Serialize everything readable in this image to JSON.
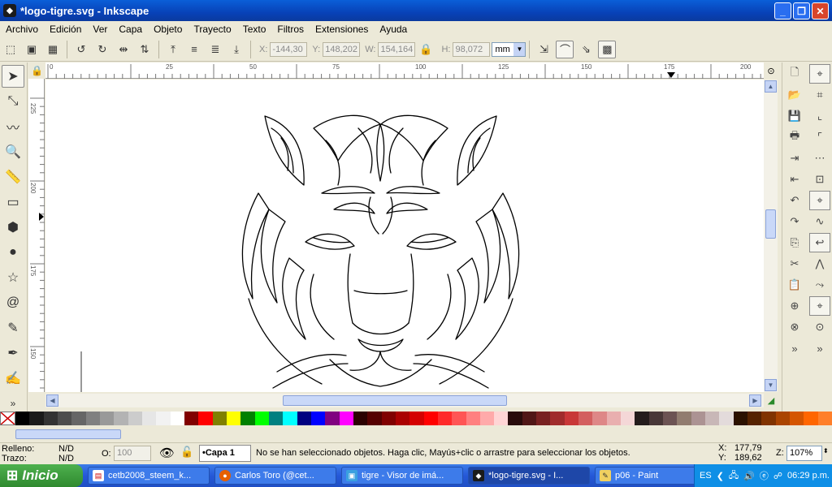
{
  "window": {
    "title": "*logo-tigre.svg - Inkscape",
    "icon": "inkscape-icon"
  },
  "menu": [
    "Archivo",
    "Edición",
    "Ver",
    "Capa",
    "Objeto",
    "Trayecto",
    "Texto",
    "Filtros",
    "Extensiones",
    "Ayuda"
  ],
  "toolbar": {
    "x_label": "X:",
    "x_value": "-144,30",
    "y_label": "Y:",
    "y_value": "148,202",
    "w_label": "W:",
    "w_value": "154,164",
    "h_label": "H:",
    "h_value": "98,072",
    "unit": "mm"
  },
  "ruler": {
    "h_ticks": [
      "0",
      "25",
      "50",
      "75",
      "100",
      "125",
      "150",
      "175",
      "200"
    ],
    "v_ticks": [
      "225",
      "200",
      "175",
      "150"
    ]
  },
  "status": {
    "fill_label": "Relleno:",
    "fill_value": "N/D",
    "stroke_label": "Trazo:",
    "stroke_value": "N/D",
    "opacity_label": "O:",
    "opacity_value": "100",
    "layer": "•Capa 1",
    "message": "No se han seleccionado objetos. Haga clic, Mayús+clic o arrastre para seleccionar los objetos.",
    "x_label": "X:",
    "x_value": "177,79",
    "y_label": "Y:",
    "y_value": "189,62",
    "zoom_label": "Z:",
    "zoom_value": "107%"
  },
  "palette": [
    "#000000",
    "#1a1a1a",
    "#333333",
    "#4d4d4d",
    "#666666",
    "#808080",
    "#999999",
    "#b3b3b3",
    "#cccccc",
    "#e6e6e6",
    "#f2f2f2",
    "#ffffff",
    "#800000",
    "#ff0000",
    "#808000",
    "#ffff00",
    "#008000",
    "#00ff00",
    "#008080",
    "#00ffff",
    "#000080",
    "#0000ff",
    "#800080",
    "#ff00ff",
    "#2b0000",
    "#550000",
    "#800000",
    "#aa0000",
    "#d40000",
    "#ff0000",
    "#ff2a2a",
    "#ff5555",
    "#ff8080",
    "#ffaaaa",
    "#ffd5d5",
    "#280b0b",
    "#501616",
    "#782121",
    "#a02c2c",
    "#c83737",
    "#d35f5f",
    "#de8787",
    "#e9afaf",
    "#f4d7d7",
    "#241c1c",
    "#483737",
    "#6c5353",
    "#917c6f",
    "#ac9393",
    "#c8b7b7",
    "#e3dbdb",
    "#2b1100",
    "#552200",
    "#803300",
    "#aa4400",
    "#d45500",
    "#ff6600",
    "#ff7f2a"
  ],
  "taskbar": {
    "start": "Inicio",
    "tasks": [
      {
        "label": "cetb2008_steem_k...",
        "icon": "pdf-icon"
      },
      {
        "label": "Carlos Toro (@cet...",
        "icon": "firefox-icon"
      },
      {
        "label": "tigre - Visor de imá...",
        "icon": "image-viewer-icon"
      },
      {
        "label": "*logo-tigre.svg - I...",
        "icon": "inkscape-icon"
      },
      {
        "label": "p06 - Paint",
        "icon": "paint-icon"
      }
    ],
    "lang": "ES",
    "clock": "06:29 p.m."
  }
}
